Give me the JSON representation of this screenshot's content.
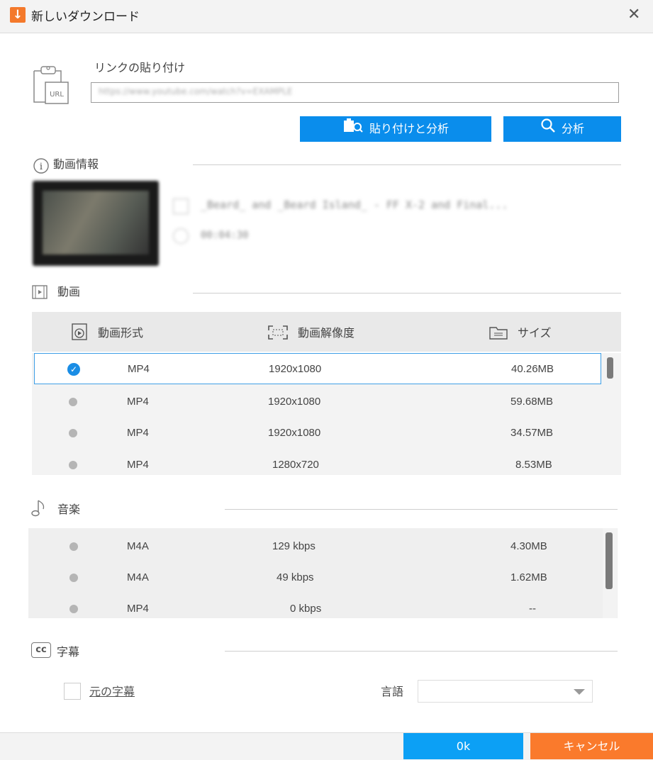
{
  "window": {
    "title": "新しいダウンロード"
  },
  "link": {
    "label": "リンクの貼り付け",
    "url_value": "https://www.youtube.com/watch?v=EXAMPLE",
    "paste_analyze_label": "貼り付けと分析",
    "analyze_label": "分析"
  },
  "video_info": {
    "heading": "動画情報",
    "title": "_Beard_ and _Beard Island_ - FF X-2 and Final...",
    "duration": "00:04:30"
  },
  "video": {
    "heading": "動画",
    "columns": [
      "動画形式",
      "動画解像度",
      "サイズ"
    ],
    "rows": [
      {
        "format": "MP4",
        "resolution": "1920x1080",
        "size": "40.26MB",
        "selected": true
      },
      {
        "format": "MP4",
        "resolution": "1920x1080",
        "size": "59.68MB",
        "selected": false
      },
      {
        "format": "MP4",
        "resolution": "1920x1080",
        "size": "34.57MB",
        "selected": false
      },
      {
        "format": "MP4",
        "resolution": "1280x720",
        "size": "8.53MB",
        "selected": false
      }
    ]
  },
  "music": {
    "heading": "音楽",
    "rows": [
      {
        "format": "M4A",
        "bitrate": "129 kbps",
        "size": "4.30MB"
      },
      {
        "format": "M4A",
        "bitrate": "49 kbps",
        "size": "1.62MB"
      },
      {
        "format": "MP4",
        "bitrate": "0 kbps",
        "size": "--"
      }
    ]
  },
  "subtitles": {
    "heading": "字幕",
    "original_label": "元の字幕",
    "language_label": "言語",
    "cc_icon_text": "cc"
  },
  "footer": {
    "ok_label": "0k",
    "cancel_label": "キャンセル"
  },
  "colors": {
    "accent_blue": "#0a8dec",
    "cancel_orange": "#fa7a2c",
    "selected_border": "#3f9fe6"
  }
}
